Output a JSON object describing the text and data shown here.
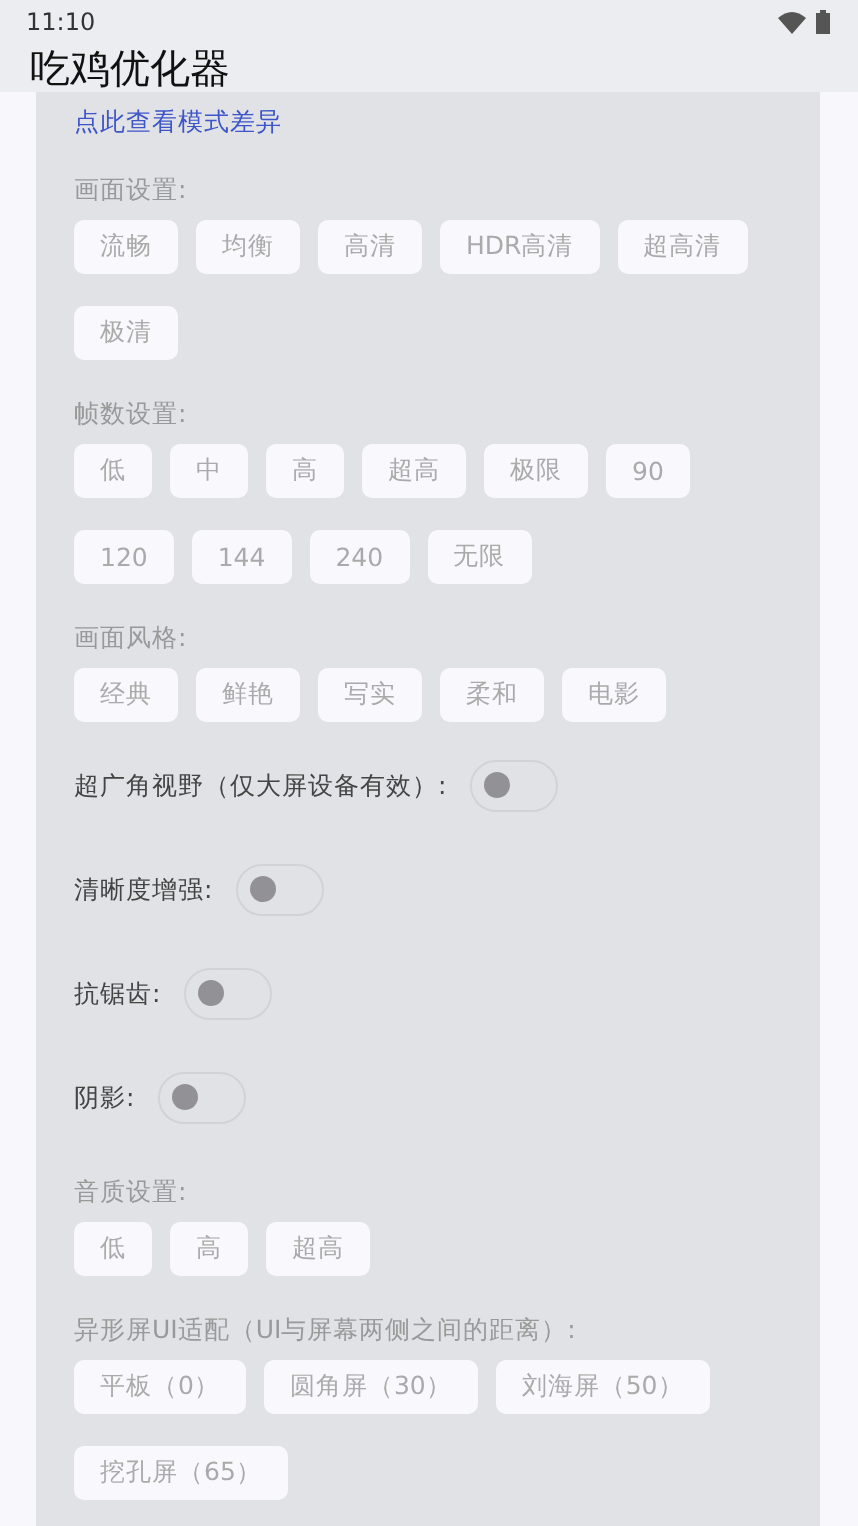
{
  "status_bar": {
    "time": "11:10"
  },
  "app_bar": {
    "title": "吃鸡优化器"
  },
  "link": "点此查看模式差异",
  "sections": [
    {
      "kind": "chips",
      "label": "画面设置:",
      "options": [
        {
          "label": "流畅",
          "selected": false
        },
        {
          "label": "均衡",
          "selected": false
        },
        {
          "label": "高清",
          "selected": false
        },
        {
          "label": "HDR高清",
          "selected": false
        },
        {
          "label": "超高清",
          "selected": false
        },
        {
          "label": "极清",
          "selected": false
        }
      ]
    },
    {
      "kind": "chips",
      "label": "帧数设置:",
      "options": [
        {
          "label": "低",
          "selected": false
        },
        {
          "label": "中",
          "selected": false
        },
        {
          "label": "高",
          "selected": false
        },
        {
          "label": "超高",
          "selected": false
        },
        {
          "label": "极限",
          "selected": false
        },
        {
          "label": "90",
          "selected": false
        },
        {
          "label": "120",
          "selected": false
        },
        {
          "label": "144",
          "selected": false
        },
        {
          "label": "240",
          "selected": false
        },
        {
          "label": "无限",
          "selected": false
        }
      ]
    },
    {
      "kind": "chips",
      "label": "画面风格:",
      "options": [
        {
          "label": "经典",
          "selected": false
        },
        {
          "label": "鲜艳",
          "selected": false
        },
        {
          "label": "写实",
          "selected": false
        },
        {
          "label": "柔和",
          "selected": false
        },
        {
          "label": "电影",
          "selected": false
        }
      ]
    },
    {
      "kind": "toggle",
      "label": "超广角视野（仅大屏设备有效）:",
      "on": false
    },
    {
      "kind": "toggle",
      "label": "清晰度增强:",
      "on": false
    },
    {
      "kind": "toggle",
      "label": "抗锯齿:",
      "on": false
    },
    {
      "kind": "toggle",
      "label": "阴影:",
      "on": false
    },
    {
      "kind": "chips",
      "label": "音质设置:",
      "options": [
        {
          "label": "低",
          "selected": false
        },
        {
          "label": "高",
          "selected": false
        },
        {
          "label": "超高",
          "selected": false
        }
      ]
    },
    {
      "kind": "chips",
      "label": "异形屏UI适配（UI与屏幕两侧之间的距离）:",
      "options": [
        {
          "label": "平板（0）",
          "selected": false
        },
        {
          "label": "圆角屏（30）",
          "selected": false
        },
        {
          "label": "刘海屏（50）",
          "selected": false
        },
        {
          "label": "挖孔屏（65）",
          "selected": false
        }
      ]
    }
  ]
}
